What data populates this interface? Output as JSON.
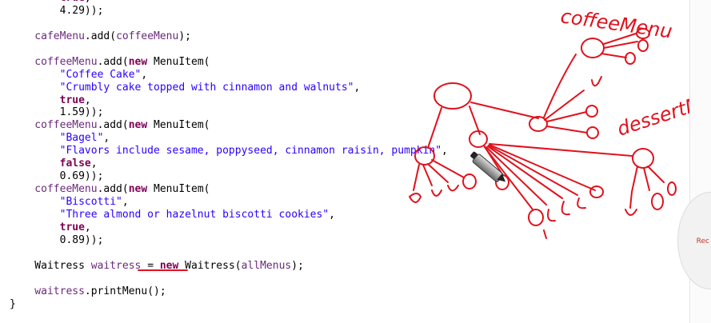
{
  "code_lines": [
    [
      {
        "k": "kw",
        "t": "        true"
      },
      {
        "k": "txt",
        "t": ","
      }
    ],
    [
      {
        "k": "num",
        "t": "        4.29"
      },
      {
        "k": "txt",
        "t": "));"
      }
    ],
    [
      {
        "k": "txt",
        "t": ""
      }
    ],
    [
      {
        "k": "id",
        "t": "    cafeMenu"
      },
      {
        "k": "txt",
        "t": ".add("
      },
      {
        "k": "id",
        "t": "coffeeMenu"
      },
      {
        "k": "txt",
        "t": ");"
      }
    ],
    [
      {
        "k": "txt",
        "t": ""
      }
    ],
    [
      {
        "k": "id",
        "t": "    coffeeMenu"
      },
      {
        "k": "txt",
        "t": ".add("
      },
      {
        "k": "kw",
        "t": "new"
      },
      {
        "k": "txt",
        "t": " MenuItem("
      }
    ],
    [
      {
        "k": "str",
        "t": "        \"Coffee Cake\""
      },
      {
        "k": "txt",
        "t": ","
      }
    ],
    [
      {
        "k": "str",
        "t": "        \"Crumbly cake topped with cinnamon and walnuts\""
      },
      {
        "k": "txt",
        "t": ","
      }
    ],
    [
      {
        "k": "kw",
        "t": "        true"
      },
      {
        "k": "txt",
        "t": ","
      }
    ],
    [
      {
        "k": "num",
        "t": "        1.59"
      },
      {
        "k": "txt",
        "t": "));"
      }
    ],
    [
      {
        "k": "id",
        "t": "    coffeeMenu"
      },
      {
        "k": "txt",
        "t": ".add("
      },
      {
        "k": "kw",
        "t": "new"
      },
      {
        "k": "txt",
        "t": " MenuItem("
      }
    ],
    [
      {
        "k": "str",
        "t": "        \"Bagel\""
      },
      {
        "k": "txt",
        "t": ","
      }
    ],
    [
      {
        "k": "str",
        "t": "        \"Flavors include sesame, poppyseed, cinnamon raisin, pumpkin\""
      },
      {
        "k": "txt",
        "t": ","
      }
    ],
    [
      {
        "k": "kw",
        "t": "        false"
      },
      {
        "k": "txt",
        "t": ","
      }
    ],
    [
      {
        "k": "num",
        "t": "        0.69"
      },
      {
        "k": "txt",
        "t": "));"
      }
    ],
    [
      {
        "k": "id",
        "t": "    coffeeMenu"
      },
      {
        "k": "txt",
        "t": ".add("
      },
      {
        "k": "kw",
        "t": "new"
      },
      {
        "k": "txt",
        "t": " MenuItem("
      }
    ],
    [
      {
        "k": "str",
        "t": "        \"Biscotti\""
      },
      {
        "k": "txt",
        "t": ","
      }
    ],
    [
      {
        "k": "str",
        "t": "        \"Three almond or hazelnut biscotti cookies\""
      },
      {
        "k": "txt",
        "t": ","
      }
    ],
    [
      {
        "k": "kw",
        "t": "        true"
      },
      {
        "k": "txt",
        "t": ","
      }
    ],
    [
      {
        "k": "num",
        "t": "        0.89"
      },
      {
        "k": "txt",
        "t": "));"
      }
    ],
    [
      {
        "k": "txt",
        "t": ""
      }
    ],
    [
      {
        "k": "txt",
        "t": "    Waitress "
      },
      {
        "k": "id",
        "t": "waitress"
      },
      {
        "k": "txt",
        "t": " = "
      },
      {
        "k": "kw",
        "t": "new"
      },
      {
        "k": "txt",
        "t": " Waitress("
      },
      {
        "k": "id",
        "t": "allMenus"
      },
      {
        "k": "txt",
        "t": ");"
      }
    ],
    [
      {
        "k": "txt",
        "t": ""
      }
    ],
    [
      {
        "k": "id",
        "t": "    waitress"
      },
      {
        "k": "txt",
        "t": ".printMenu();"
      }
    ],
    [
      {
        "k": "txt",
        "t": "}"
      }
    ]
  ],
  "annotations": {
    "coffee_label": "coffeeMenu",
    "dessert_label": "dessertMenu",
    "ink_color": "#e0121d"
  },
  "radial_menu": {
    "label": "Rec"
  },
  "syntax_colors": {
    "identifier": "#6a2a7a",
    "keyword": "#7f0055",
    "string": "#2a00ff"
  }
}
